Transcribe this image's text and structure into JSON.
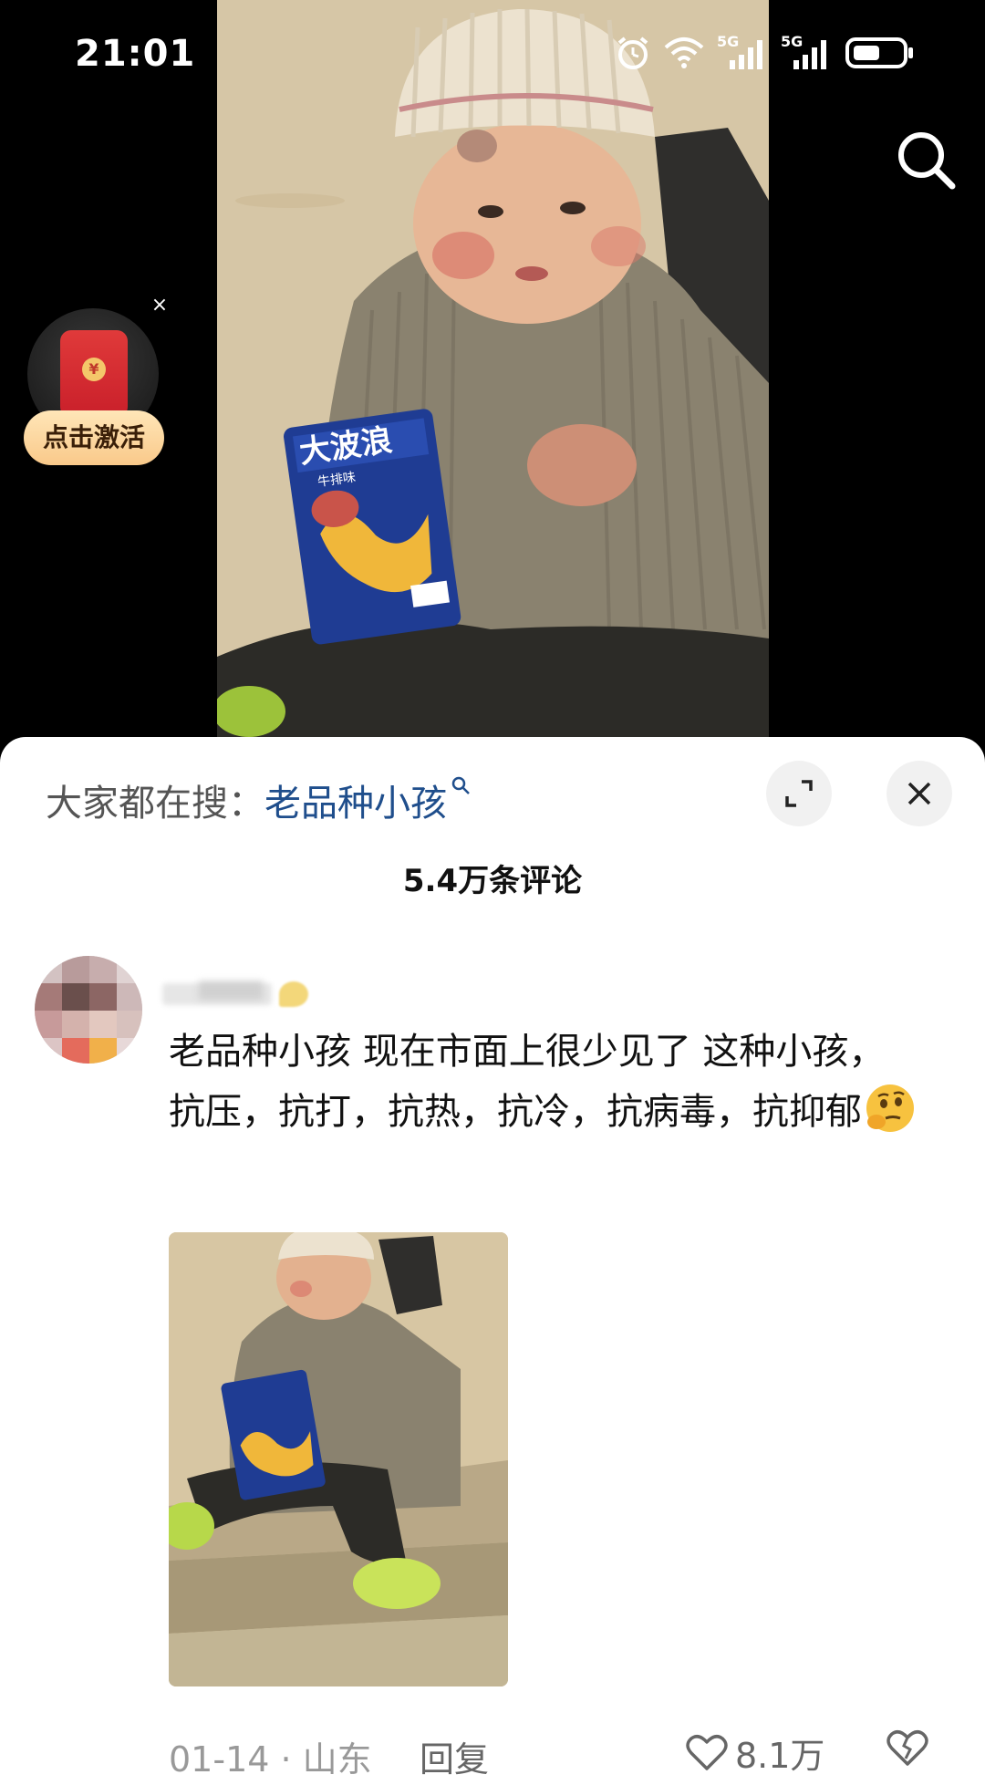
{
  "status_bar": {
    "time": "21:01",
    "network_1": "5G",
    "network_2": "5G",
    "icons": [
      "alarm-icon",
      "wifi-icon",
      "signal-icon",
      "signal-icon",
      "battery-icon"
    ]
  },
  "video": {
    "snack_brand": "大波浪",
    "snack_flavor": "牛排味"
  },
  "red_packet": {
    "label": "点击激活",
    "close": "×",
    "coin": "¥"
  },
  "comments_sheet": {
    "search_prefix": "大家都在搜：",
    "search_term": "老品种小孩",
    "count_label": "5.4万条评论"
  },
  "comment": {
    "text": "老品种小孩 现在市面上很少见了 这种小孩，抗压，抗打，抗热，抗冷，抗病毒，抗抑郁",
    "date_location": "01-14 · 山东",
    "reply_label": "回复",
    "like_count": "8.1万"
  },
  "colors": {
    "accent_link": "#1f4e8c",
    "sheet_bg": "#ffffff",
    "meta_text": "#999999"
  }
}
